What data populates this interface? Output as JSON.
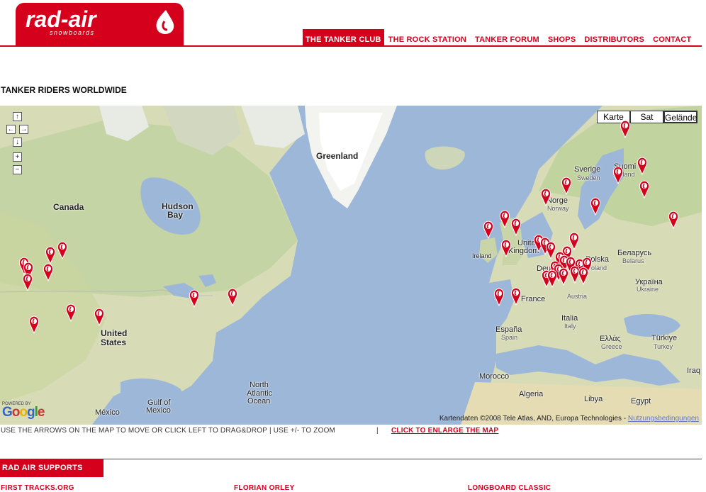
{
  "header": {
    "logo_text": "rad-air",
    "logo_subtext": "snowboards",
    "nav": [
      {
        "label": "THE TANKER CLUB",
        "active": true
      },
      {
        "label": "THE ROCK STATION",
        "active": false
      },
      {
        "label": "TANKER FORUM",
        "active": false
      },
      {
        "label": "SHOPS",
        "active": false
      },
      {
        "label": "DISTRIBUTORS",
        "active": false
      },
      {
        "label": "CONTACT",
        "active": false
      }
    ]
  },
  "page_title": "TANKER RIDERS WORLDWIDE",
  "map": {
    "controls": {
      "up": "↑",
      "left": "←",
      "right": "→",
      "down": "↓",
      "zoom_in": "+",
      "zoom_out": "−"
    },
    "map_types": [
      "Karte",
      "Sat",
      "Gelände"
    ],
    "selected_type": "Gelände",
    "labels": {
      "greenland": "Greenland",
      "canada": "Canada",
      "hudson": "Hudson",
      "bay": "Bay",
      "united": "United",
      "states": "States",
      "mexico": "México",
      "gulf1": "Gulf of",
      "gulf2": "Mexico",
      "nao1": "North",
      "nao2": "Atlantic",
      "nao3": "Ocean",
      "ireland": "Ireland",
      "uk1": "United",
      "uk2": "Kingdom",
      "norway1": "Norge",
      "norway2": "Norway",
      "sverige": "Sverige",
      "sweden": "Sweden",
      "suomi": "Suomi",
      "finland": "Finland",
      "polska": "Polska",
      "poland": "Poland",
      "belarus1": "Беларусь",
      "belarus2": "Belarus",
      "ukraine1": "Україна",
      "ukraine2": "Ukraine",
      "france": "France",
      "espana": "España",
      "spain": "Spain",
      "italia": "Italia",
      "italy": "Italy",
      "ellas": "Ελλάς",
      "greece": "Greece",
      "turkiye": "Türkiye",
      "turkey": "Turkey",
      "morocco": "Morocco",
      "algeria": "Algeria",
      "libya": "Libya",
      "egypt": "Egypt",
      "iraq": "Iraq",
      "austria": "Austria",
      "de": "Deu"
    },
    "powered_by": "POWERED BY",
    "google": "Google",
    "copyright": "Kartendaten ©2008 Tele Atlas, AND, Europa Technologies -",
    "terms": "Nutzungsbedingungen"
  },
  "instructions": "USE THE ARROWS ON THE MAP TO MOVE OR CLICK LEFT TO DRAG&DROP | USE +/- TO ZOOM",
  "separator": "|",
  "enlarge_link": "CLICK TO ENLARGE THE MAP",
  "supports_heading": "RAD AIR SUPPORTS",
  "partners": [
    "FIRST TRACKS.ORG",
    "FLORIAN ORLEY",
    "LONGBOARD CLASSIC"
  ],
  "colors": {
    "brand_red": "#d5001c",
    "water": "#9db7d8",
    "land": "#d7dcb6"
  }
}
